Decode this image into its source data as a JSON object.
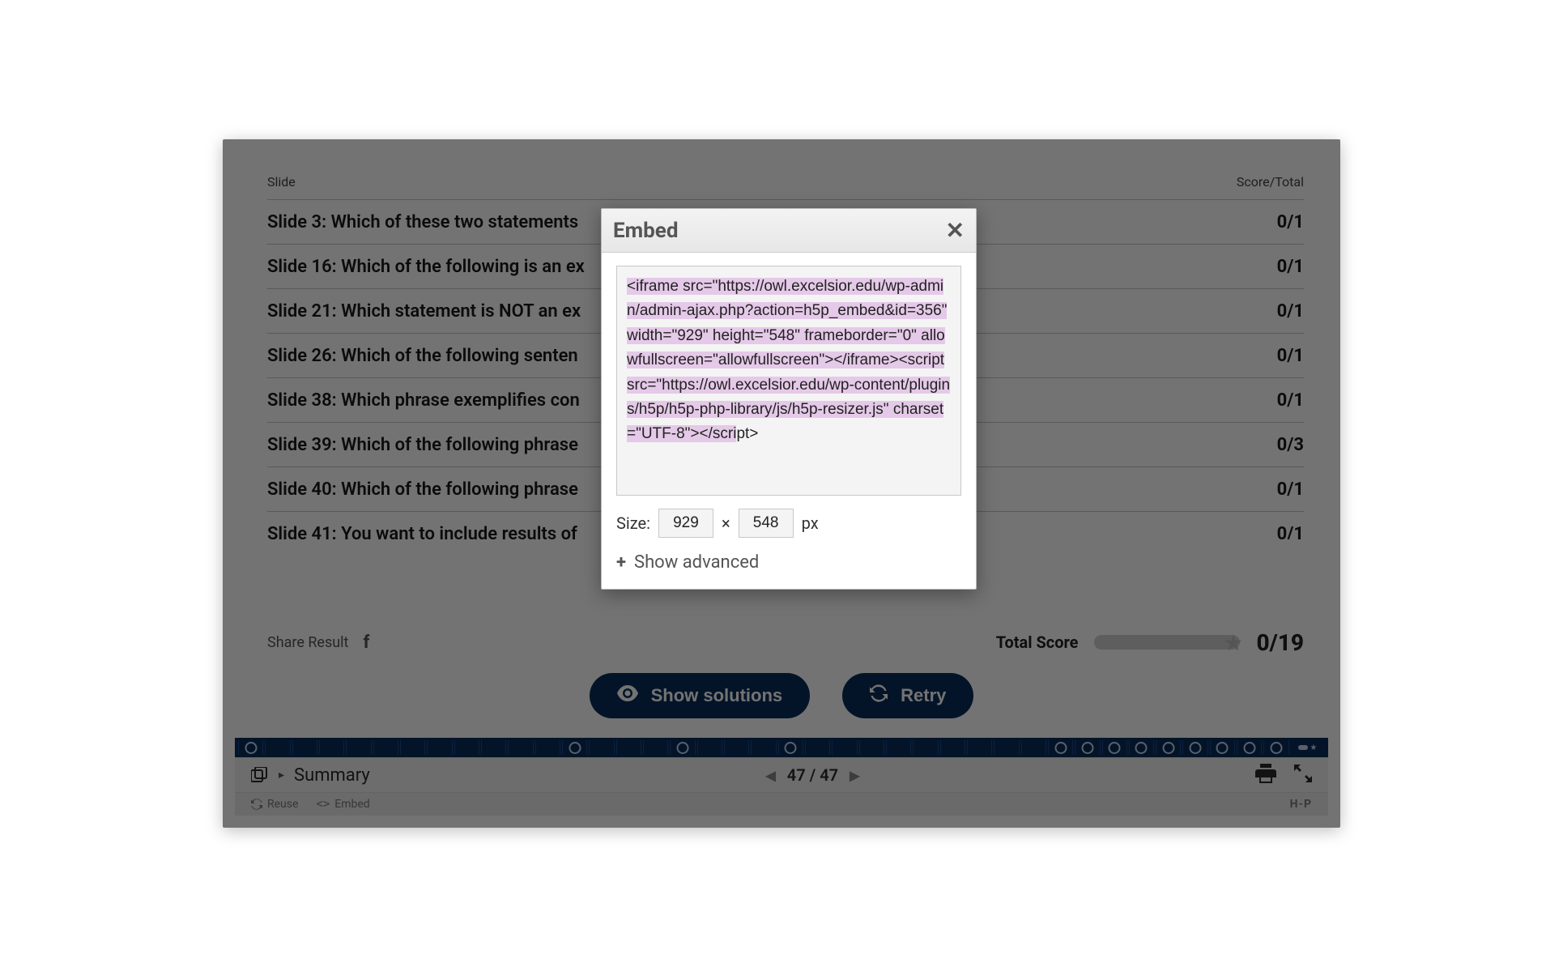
{
  "table": {
    "header_left": "Slide",
    "header_right": "Score/Total",
    "rows": [
      {
        "title": "Slide 3: Which of these two statements",
        "score": "0/1"
      },
      {
        "title": "Slide 16: Which of the following is an ex",
        "score": "0/1"
      },
      {
        "title": "Slide 21: Which statement is NOT an ex",
        "score": "0/1"
      },
      {
        "title": "Slide 26: Which of the following senten",
        "score": "0/1"
      },
      {
        "title": "Slide 38: Which phrase exemplifies con",
        "score": "0/1"
      },
      {
        "title": "Slide 39: Which of the following phrase",
        "score": "0/3"
      },
      {
        "title": "Slide 40: Which of the following phrase",
        "score": "0/1"
      },
      {
        "title": "Slide 41: You want to include results of",
        "score": "0/1"
      }
    ]
  },
  "share": {
    "label": "Share Result",
    "total_label": "Total Score",
    "total_value": "0/19"
  },
  "buttons": {
    "show_solutions": "Show solutions",
    "retry": "Retry"
  },
  "footer1": {
    "title": "Summary",
    "page_current": "47",
    "page_total": "47"
  },
  "footer2": {
    "reuse": "Reuse",
    "embed": "Embed",
    "logo": "H-P"
  },
  "modal": {
    "title": "Embed",
    "code": "<iframe src=\"https://owl.excelsior.edu/wp-admin/admin-ajax.php?action=h5p_embed&id=356\" width=\"929\" height=\"548\" frameborder=\"0\" allowfullscreen=\"allowfullscreen\"></iframe><script src=\"https://owl.excelsior.edu/wp-content/plugins/h5p/h5p-php-library/js/h5p-resizer.js\" charset=\"UTF-8\"></scri",
    "code_tail": "pt>",
    "size_label": "Size:",
    "width": "929",
    "height": "548",
    "px": "px",
    "advanced": "Show advanced"
  },
  "progress_circles": [
    1,
    0,
    0,
    0,
    0,
    0,
    0,
    0,
    0,
    0,
    0,
    0,
    1,
    0,
    0,
    0,
    1,
    0,
    0,
    0,
    1,
    0,
    0,
    0,
    0,
    0,
    0,
    0,
    0,
    0,
    1,
    1,
    1,
    1,
    1,
    1,
    1,
    1,
    1
  ]
}
